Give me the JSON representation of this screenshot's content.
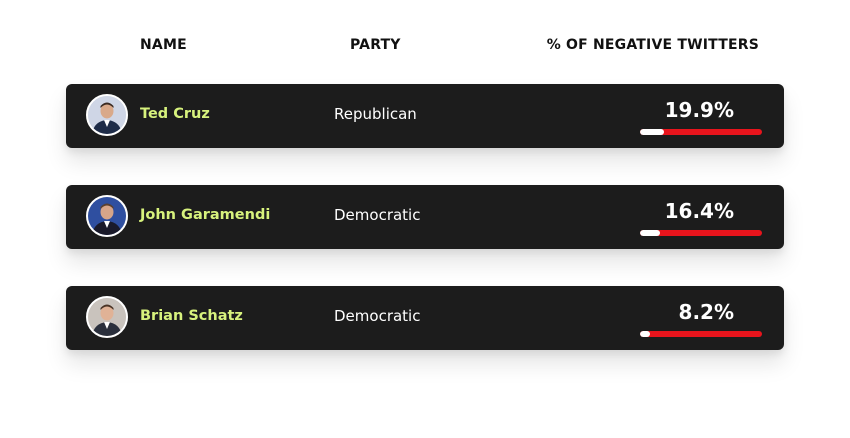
{
  "header": {
    "name": "NAME",
    "party": "PARTY",
    "negative": "% OF NEGATIVE TWITTERS"
  },
  "rows": [
    {
      "name": "Ted Cruz",
      "party": "Republican",
      "percent_label": "19.9%",
      "percent": 19.9,
      "avatar_bg": "#cfd6e6",
      "suit_color": "#1e2c48"
    },
    {
      "name": "John Garamendi",
      "party": "Democratic",
      "percent_label": "16.4%",
      "percent": 16.4,
      "avatar_bg": "#2f4fa0",
      "suit_color": "#1a1a2a"
    },
    {
      "name": "Brian Schatz",
      "party": "Democratic",
      "percent_label": "8.2%",
      "percent": 8.2,
      "avatar_bg": "#c9c3bd",
      "suit_color": "#2a2f3c"
    }
  ],
  "colors": {
    "name_text": "#d7f27d",
    "row_bg": "#1c1c1c",
    "bar_bg": "#e8141c",
    "bar_fill": "#ffffff"
  }
}
